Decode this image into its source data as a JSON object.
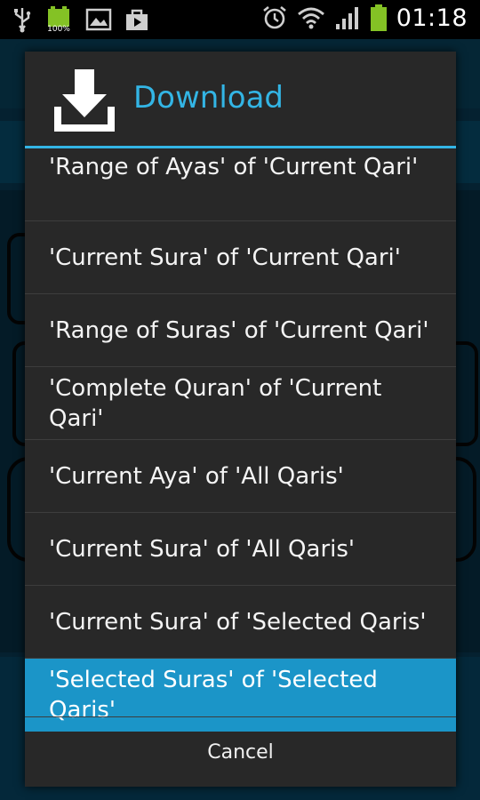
{
  "status_bar": {
    "time": "01:18",
    "battery_left_label": "100%",
    "icons": [
      "usb-icon",
      "battery-full-icon",
      "gallery-icon",
      "store-icon",
      "alarm-icon",
      "wifi-icon",
      "signal-icon",
      "battery-icon"
    ]
  },
  "dialog": {
    "title": "Download",
    "icon": "download-icon",
    "accent_color": "#33b5e5",
    "selected_color": "#1b95c8",
    "options": [
      {
        "label": "'Range of Ayas' of 'Current Qari'",
        "selected": false
      },
      {
        "label": "'Current Sura' of 'Current Qari'",
        "selected": false
      },
      {
        "label": "'Range of Suras' of 'Current Qari'",
        "selected": false
      },
      {
        "label": "'Complete Quran' of 'Current Qari'",
        "selected": false
      },
      {
        "label": "'Current Aya' of 'All Qaris'",
        "selected": false
      },
      {
        "label": "'Current Sura' of 'All Qaris'",
        "selected": false
      },
      {
        "label": "'Current Sura' of 'Selected Qaris'",
        "selected": false
      },
      {
        "label": "'Selected Suras' of 'Selected Qaris'",
        "selected": true
      }
    ],
    "cancel_label": "Cancel"
  }
}
